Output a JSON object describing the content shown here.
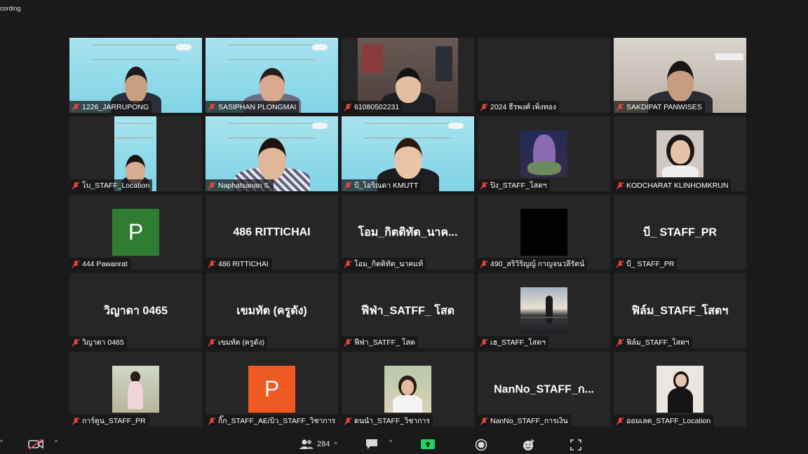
{
  "recording_label": "cording",
  "participant_count": "284",
  "tiles": [
    {
      "name": "1226_JARRUPONG"
    },
    {
      "name": "SASIPHAN PLONGMAI"
    },
    {
      "name": "61080502231"
    },
    {
      "name": "2024 ธีรพงศ์ เพิ่งทอง"
    },
    {
      "name": "SAKDIPAT PANWISES"
    },
    {
      "name": "โบ_STAFF_Location"
    },
    {
      "name": "Naphatsanan S."
    },
    {
      "name": "บี_ไอริณดา KMUTT"
    },
    {
      "name": "ปิง_STAFF_โสตฯ"
    },
    {
      "name": "KODCHARAT KLINHOMKRUN"
    },
    {
      "name": "444 Pawanrat",
      "letter": "P"
    },
    {
      "name": "486 RITTICHAI",
      "display": "486 RITTICHAI"
    },
    {
      "name": "โอม_กิตติทัต_นาคแท้",
      "display": "โอม_กิตติทัต_นาค..."
    },
    {
      "name": "490_สริวิริญญ์ กาญจนวลีรัตน์"
    },
    {
      "name": "บี_ STAFF_PR",
      "display": "บี_ STAFF_PR"
    },
    {
      "name": "วิญาดา 0465",
      "display": "วิญาดา 0465"
    },
    {
      "name": "เขมทัต (ครูดัง)",
      "display": "เขมทัต (ครูดัง)"
    },
    {
      "name": "ฟีฟ่า_SATFF_ โสต",
      "display": "ฟีฟ่า_SATFF_ โสต"
    },
    {
      "name": "เฮ_STAFF_โสตฯ"
    },
    {
      "name": "ฟิล์ม_STAFF_โสตฯ",
      "display": "ฟิล์ม_STAFF_โสตฯ"
    },
    {
      "name": "การ์ตูน_STAFF_PR"
    },
    {
      "name": "กิ๊ก_STAFF_AE/บิว_STAFF_วิชาการ",
      "letter": "P"
    },
    {
      "name": "ดนนํา_STAFF_วิชาการ"
    },
    {
      "name": "NanNo_STAFF_การเงิน",
      "display": "NanNo_STAFF_ก..."
    },
    {
      "name": "ออมเลต_STAFF_Location"
    }
  ]
}
